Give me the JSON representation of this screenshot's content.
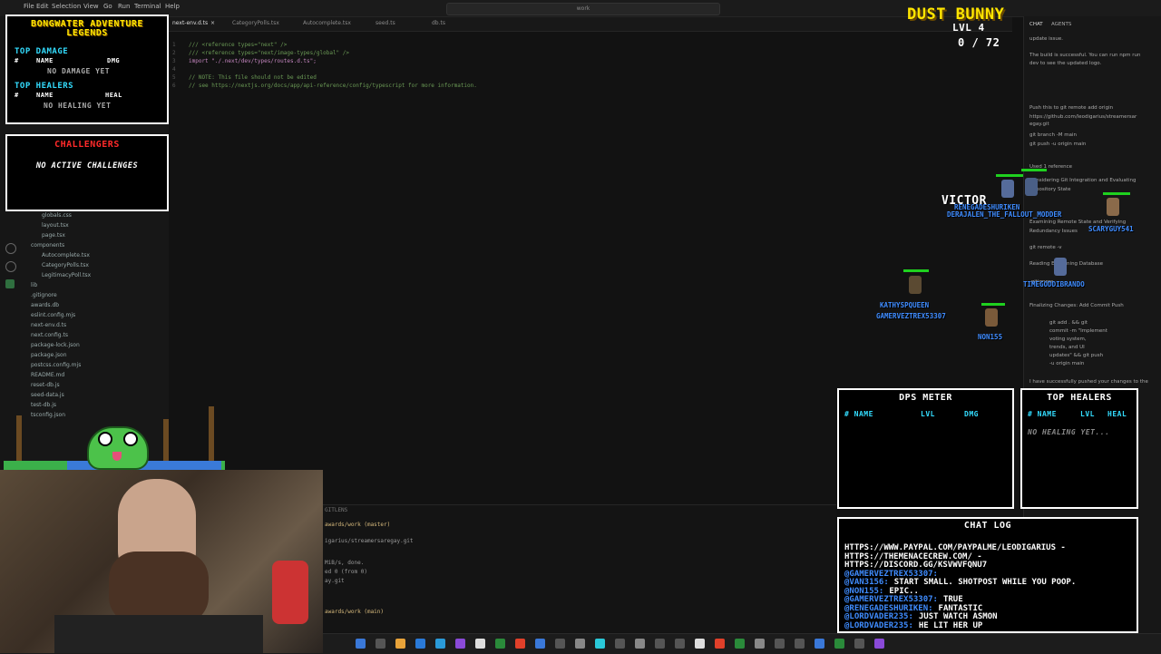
{
  "editor": {
    "menu": [
      "File",
      "Edit",
      "Selection",
      "View",
      "Go",
      "Run",
      "Terminal",
      "Help"
    ],
    "search_text": "work",
    "tabs": [
      "next-env.d.ts",
      "CategoryPolls.tsx",
      "Autocomplete.tsx",
      "seed.ts",
      "db.ts"
    ],
    "files": [
      "globals.css",
      "layout.tsx",
      "page.tsx",
      "components",
      "Autocomplete.tsx",
      "CategoryPolls.tsx",
      "LegitimacyPoll.tsx",
      "lib",
      ".gitignore",
      "awards.db",
      "eslint.config.mjs",
      "next-env.d.ts",
      "next.config.ts",
      "package-lock.json",
      "package.json",
      "postcss.config.mjs",
      "README.md",
      "reset-db.js",
      "seed-data.js",
      "test-db.js",
      "tsconfig.json"
    ],
    "code_lines": [
      {
        "n": "1",
        "text": "/// <reference types=\"next\" />",
        "color": "#6a9955"
      },
      {
        "n": "2",
        "text": "/// <reference types=\"next/image-types/global\" />",
        "color": "#6a9955"
      },
      {
        "n": "3",
        "text": "import \"./.next/dev/types/routes.d.ts\";",
        "color": "#c586c0"
      },
      {
        "n": "4",
        "text": "",
        "color": "#ccc"
      },
      {
        "n": "5",
        "text": "// NOTE: This file should not be edited",
        "color": "#6a9955"
      },
      {
        "n": "6",
        "text": "// see https://nextjs.org/docs/app/api-reference/config/typescript for more information.",
        "color": "#6a9955"
      }
    ],
    "terminal_lines": [
      "awards/work (master)",
      "igarius/streamersaregay.git",
      "MiB/s, done.",
      "ed 0 (from 0)",
      "ay.git",
      "awards/work (main)"
    ],
    "terminal_tab": "GITLENS"
  },
  "right_panel": {
    "tabs": [
      "CHAT",
      "AGENTS"
    ],
    "lines": [
      "update issue.",
      "The build is successful. You can run npm run",
      "dev to see the updated logo.",
      "Push this to git remote add origin",
      "https://github.com/leodigarius/streamersar",
      "egay.git",
      "git branch -M main",
      "git push -u origin main",
      "Used 1 reference",
      "Considering Git Integration and Evaluating",
      "Repository State",
      "Examining Remote State and Verifying",
      "Redundancy Issues",
      "git remote -v",
      "Reading Examining Database",
      ".gitignore",
      "Finalizing Changes: Add Commit Push",
      "git add . && git",
      "commit -m \"Implement",
      "voting system,",
      "trends, and UI",
      "updates\" && git push",
      "-u origin main",
      "I have successfully pushed your changes to the"
    ]
  },
  "overlay": {
    "legends_title": "BONGWATER ADVENTURE LEGENDS",
    "top_damage": {
      "title": "TOP DAMAGE",
      "col1": "NAME",
      "col2": "DMG",
      "empty": "NO DAMAGE YET"
    },
    "top_healers_small": {
      "title": "TOP HEALERS",
      "col1": "NAME",
      "col2": "HEAL",
      "empty": "NO HEALING YET"
    },
    "challengers": {
      "title": "CHALLENGERS",
      "empty": "NO ACTIVE CHALLENGES"
    },
    "boss": {
      "name": "DUST BUNNY",
      "level": "LVL 4",
      "hp_text": "0 / 72"
    },
    "victory_text": "VICTOR",
    "players": [
      "RENEGADESHURIKEN",
      "DERAJALEN_THE_FALLOUT_MODDER",
      "SCARYGUY541",
      "TIMEGODDIBRANDO",
      "KATHYSPQUEEN",
      "GAMERVEZTREX53307",
      "NON155"
    ],
    "dps_meter": {
      "title": "DPS METER",
      "c1": "# NAME",
      "c2": "LVL",
      "c3": "DMG"
    },
    "top_healers": {
      "title": "TOP HEALERS",
      "c1": "# NAME",
      "c2": "LVL",
      "c3": "HEAL",
      "empty": "NO HEALING YET..."
    },
    "chat_log": {
      "title": "CHAT LOG",
      "lines": [
        {
          "user": "",
          "text": "HTTPS://WWW.PAYPAL.COM/PAYPALME/LEODIGARIUS -"
        },
        {
          "user": "",
          "text": "HTTPS://THEMENACECREW.COM/ -"
        },
        {
          "user": "",
          "text": "HTTPS://DISCORD.GG/KSVWVFQNU7"
        },
        {
          "user": "@GAMERVEZTREX53307:",
          "text": ""
        },
        {
          "user": "@VAN3156:",
          "text": "START SMALL. SHOTPOST WHILE YOU POOP."
        },
        {
          "user": "@NON155:",
          "text": "EPIC.."
        },
        {
          "user": "@GAMERVEZTREX53307:",
          "text": "TRUE"
        },
        {
          "user": "@RENEGADESHURIKEN:",
          "text": "FANTASTIC"
        },
        {
          "user": "@LORDVADER235:",
          "text": "JUST WATCH ASMON"
        },
        {
          "user": "@LORDVADER235:",
          "text": "HE LIT HER UP"
        }
      ]
    }
  },
  "colors": {
    "title_yellow": "#ffe600",
    "cyan": "#33ddff",
    "red": "#ff2a2a",
    "green": "#1fd11f",
    "user_blue": "#3f8cff"
  }
}
